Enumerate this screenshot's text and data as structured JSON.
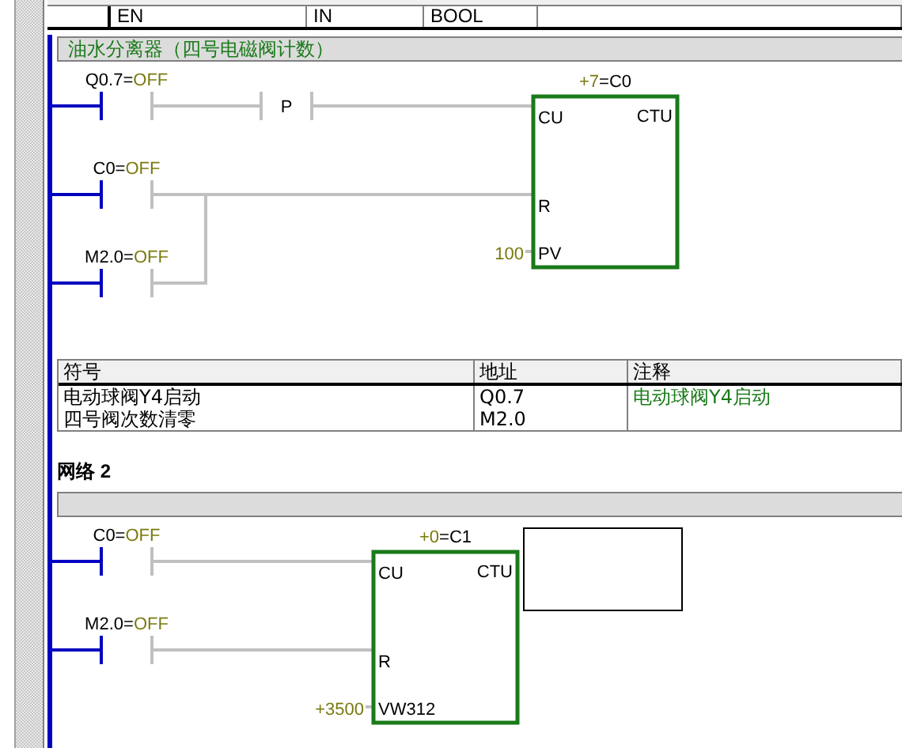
{
  "variable_table": {
    "rows": [
      {
        "name": "EN",
        "var_type": "IN",
        "data_type": "BOOL"
      }
    ]
  },
  "networks": [
    {
      "comment": "油水分离器（四号电磁阀计数）",
      "box": {
        "type": "CTU",
        "value": "+7",
        "name": "=C0",
        "pins": [
          {
            "label": "CU",
            "branches": [
              [
                {
                  "kind": "contact",
                  "operand": "Q0.7=",
                  "status": "OFF",
                  "closed": false
                },
                {
                  "kind": "positive_transition",
                  "label": "P"
                }
              ]
            ]
          },
          {
            "label": "R",
            "branches": [
              [
                {
                  "kind": "contact",
                  "operand": "C0=",
                  "status": "OFF",
                  "closed": false
                }
              ],
              [
                {
                  "kind": "contact",
                  "operand": "M2.0=",
                  "status": "OFF",
                  "closed": false
                }
              ]
            ]
          },
          {
            "label": "PV",
            "value": "100"
          }
        ]
      },
      "symbol_table": {
        "columns": [
          "符号",
          "地址",
          "注释"
        ],
        "rows": [
          {
            "symbol": "电动球阀Y4启动",
            "address": "Q0.7",
            "comment": "电动球阀Y4启动"
          },
          {
            "symbol": "四号阀次数清零",
            "address": "M2.0"
          }
        ]
      }
    },
    {
      "title": "网络 2",
      "box": {
        "type": "CTU",
        "value": "+0",
        "name": "=C1",
        "pins": [
          {
            "label": "CU",
            "branches": [
              [
                {
                  "kind": "contact",
                  "operand": "C0=",
                  "status": "OFF",
                  "closed": false
                }
              ]
            ]
          },
          {
            "label": "R",
            "branches": [
              [
                {
                  "kind": "contact",
                  "operand": "M2.0=",
                  "status": "OFF",
                  "closed": false
                }
              ]
            ]
          },
          {
            "label": "VW312",
            "value": "+3500"
          }
        ]
      },
      "output_box": true
    }
  ]
}
